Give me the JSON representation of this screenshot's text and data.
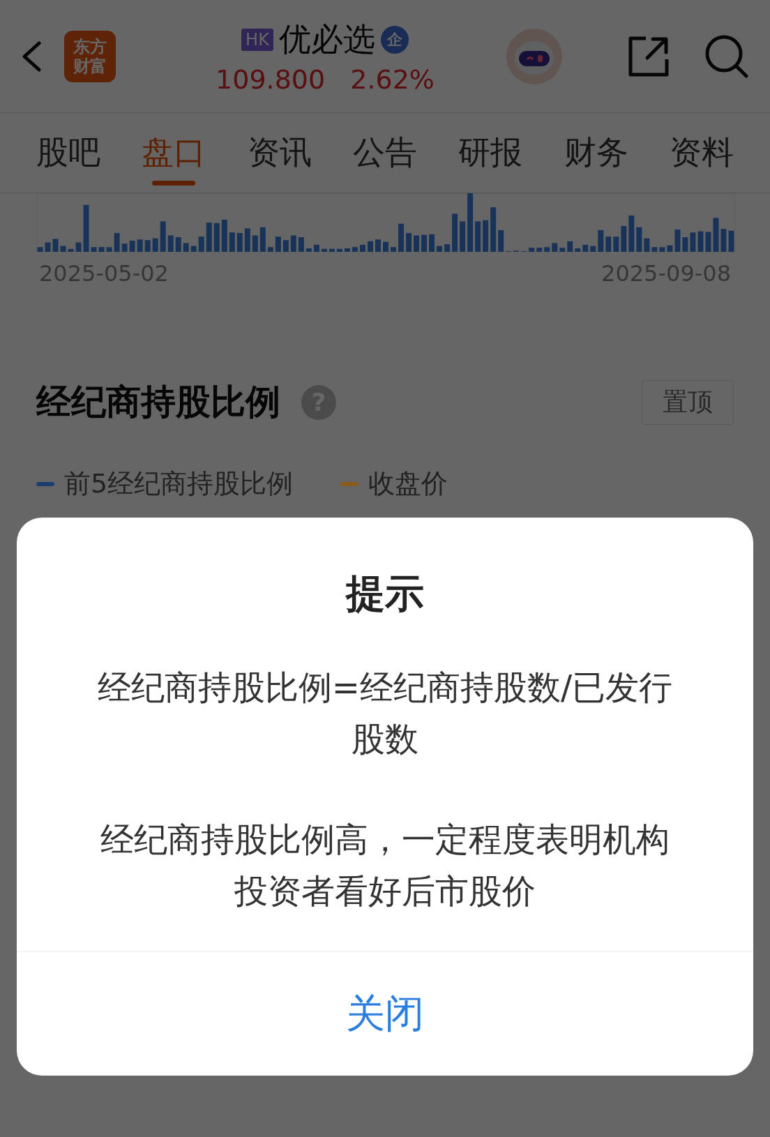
{
  "header": {
    "logo_lines": [
      "东方",
      "财富"
    ],
    "market_badge": "HK",
    "stock_name": "优必选",
    "enterprise_badge": "企",
    "price": "109.800",
    "change": "2.62%"
  },
  "tabs": [
    {
      "label": "股吧",
      "selected": false
    },
    {
      "label": "盘口",
      "selected": true
    },
    {
      "label": "资讯",
      "selected": false
    },
    {
      "label": "公告",
      "selected": false
    },
    {
      "label": "研报",
      "selected": false
    },
    {
      "label": "财务",
      "selected": false
    },
    {
      "label": "资料",
      "selected": false
    }
  ],
  "volume_chart": {
    "start_date": "2025-05-02",
    "end_date": "2025-09-08"
  },
  "section": {
    "title": "经纪商持股比例",
    "help_icon": "?",
    "pin_button": "置顶",
    "legend": [
      {
        "label": "前5经纪商持股比例",
        "color": "#1c3f72"
      },
      {
        "label": "收盘价",
        "color": "#8a5c1c"
      }
    ]
  },
  "dialog": {
    "title": "提示",
    "paragraphs": [
      "经纪商持股比例=经纪商持股数/已发行股数",
      "经纪商持股比例高，一定程度表明机构投资者看好后市股价"
    ],
    "close_button": "关闭"
  }
}
